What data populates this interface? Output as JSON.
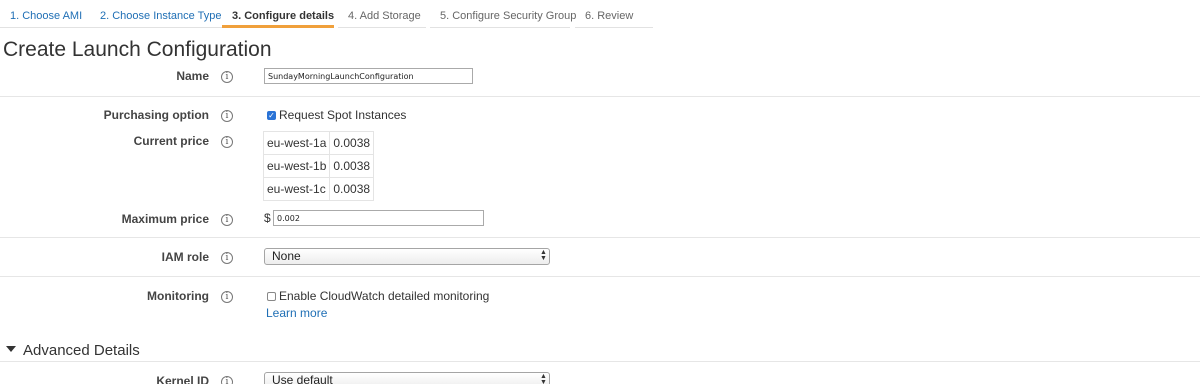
{
  "wizard": {
    "steps": [
      {
        "label": "1. Choose AMI",
        "state": "done"
      },
      {
        "label": "2. Choose Instance Type",
        "state": "done"
      },
      {
        "label": "3. Configure details",
        "state": "active"
      },
      {
        "label": "4. Add Storage",
        "state": "future"
      },
      {
        "label": "5. Configure Security Group",
        "state": "future"
      },
      {
        "label": "6. Review",
        "state": "future"
      }
    ]
  },
  "page": {
    "title": "Create Launch Configuration"
  },
  "form": {
    "info_glyph": "i",
    "name": {
      "label": "Name",
      "value": "SundayMorningLaunchConfiguration"
    },
    "purchasing": {
      "label": "Purchasing option",
      "checkbox_label": "Request Spot Instances",
      "checked": true
    },
    "current_price": {
      "label": "Current price",
      "rows": [
        {
          "zone": "eu-west-1a",
          "price": "0.0038"
        },
        {
          "zone": "eu-west-1b",
          "price": "0.0038"
        },
        {
          "zone": "eu-west-1c",
          "price": "0.0038"
        }
      ]
    },
    "max_price": {
      "label": "Maximum price",
      "currency": "$",
      "value": "0.002"
    },
    "iam_role": {
      "label": "IAM role",
      "selected": "None"
    },
    "monitoring": {
      "label": "Monitoring",
      "checkbox_label": "Enable CloudWatch detailed monitoring",
      "checked": false,
      "link": "Learn more"
    }
  },
  "advanced": {
    "header": "Advanced Details",
    "kernel_id": {
      "label": "Kernel ID",
      "selected": "Use default"
    }
  },
  "icons": {
    "info": "info-icon",
    "select_arrows": "up-down-arrows-icon",
    "checkbox_check": "checkmark-icon",
    "section_toggle": "caret-down-icon"
  },
  "colors": {
    "link": "#1f6fb5",
    "active_step_underline": "#f0a03b",
    "checkbox_checked": "#2a73d6"
  }
}
